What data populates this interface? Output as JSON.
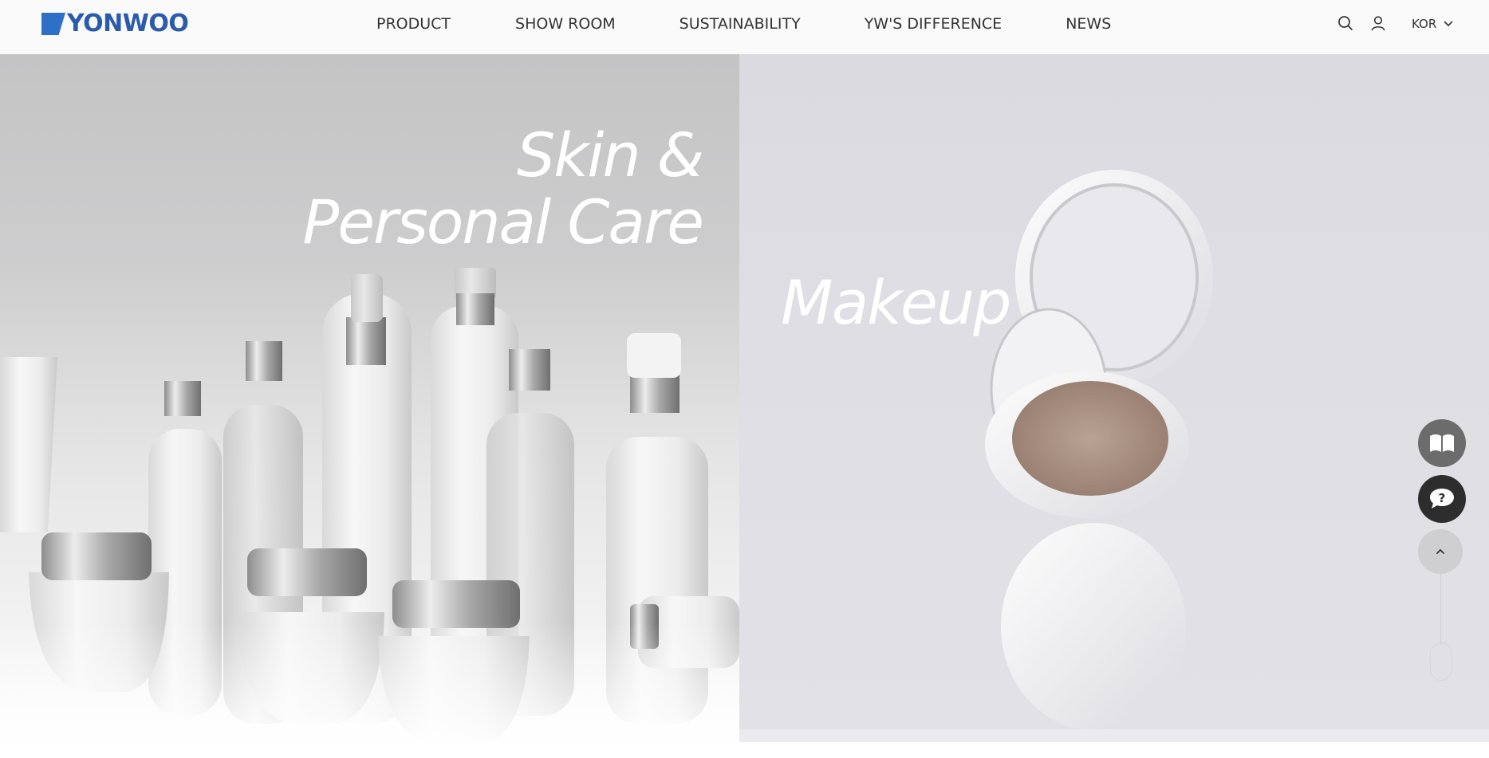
{
  "header": {
    "brand": "YONWOO",
    "nav": [
      "PRODUCT",
      "SHOW ROOM",
      "SUSTAINABILITY",
      "YW'S DIFFERENCE",
      "NEWS"
    ],
    "language": "KOR"
  },
  "hero": {
    "left": {
      "line1": "Skin &",
      "line2": "Personal Care"
    },
    "right": {
      "line1": "Makeup"
    }
  },
  "icons": {
    "search": "search-icon",
    "user": "user-icon",
    "dropdown": "chevron-down-icon",
    "catalog": "book-icon",
    "chat": "chat-question-icon",
    "top": "chevron-up-icon",
    "scroll": "mouse-icon"
  },
  "colors": {
    "brand": "#2a5cab",
    "header_bg": "#fafafb",
    "chat_btn": "#2d2d2d",
    "catalog_btn": "#6c6c6d"
  }
}
